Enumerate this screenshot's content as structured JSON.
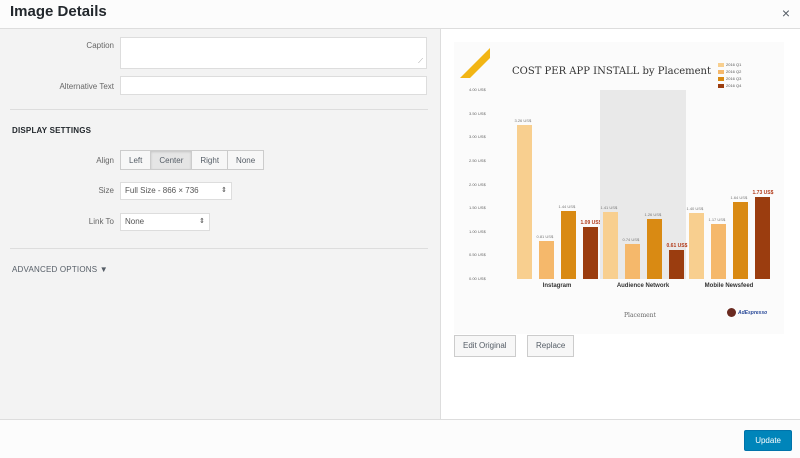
{
  "header": {
    "title": "Image Details",
    "close_glyph": "×"
  },
  "settings": {
    "caption_label": "Caption",
    "caption_value": "",
    "alt_text_label": "Alternative Text",
    "alt_text_value": "",
    "display_settings_title": "DISPLAY SETTINGS",
    "align_label": "Align",
    "align_options": [
      "Left",
      "Center",
      "Right",
      "None"
    ],
    "align_selected": "Center",
    "size_label": "Size",
    "size_value": "Full Size - 866 × 736",
    "link_to_label": "Link To",
    "link_to_value": "None",
    "advanced_options_label": "ADVANCED OPTIONS ▼"
  },
  "preview": {
    "edit_original_label": "Edit Original",
    "replace_label": "Replace"
  },
  "chart_data": {
    "type": "bar",
    "title": "COST PER APP INSTALL by Placement",
    "xlabel": "Placement",
    "ylabel": "",
    "categories": [
      "Instagram",
      "Audience Network",
      "Mobile Newsfeed"
    ],
    "series": [
      {
        "name": "2016 Q1",
        "color": "#f8cf8f",
        "values": [
          3.26,
          1.41,
          1.4
        ]
      },
      {
        "name": "2016 Q2",
        "color": "#f5b86b",
        "values": [
          0.81,
          0.74,
          1.17
        ]
      },
      {
        "name": "2016 Q3",
        "color": "#d98a13",
        "values": [
          1.44,
          1.26,
          1.64
        ]
      },
      {
        "name": "2016 Q4",
        "color": "#9b3d0f",
        "values": [
          1.09,
          0.61,
          1.73
        ]
      }
    ],
    "value_labels": [
      [
        "3.26 US$",
        "0.81 US$",
        "1.44 US$",
        "1.09 US$"
      ],
      [
        "1.41 US$",
        "0.74 US$",
        "1.26 US$",
        "0.61 US$"
      ],
      [
        "1.40 US$",
        "1.17 US$",
        "1.64 US$",
        "1.73 US$"
      ]
    ],
    "yticks": [
      "4.00 US$",
      "3.50 US$",
      "3.00 US$",
      "2.50 US$",
      "2.00 US$",
      "1.50 US$",
      "1.00 US$",
      "0.50 US$",
      "0.00 US$"
    ],
    "ylim": [
      0,
      4
    ],
    "highlighted_category": "Audience Network",
    "legend_position": "top-right",
    "grid": true
  },
  "logo_text": "AdEspresso",
  "footer": {
    "update_label": "Update"
  },
  "colors": {
    "accent": "#0085ba",
    "panel": "#f3f3f3",
    "highlight_value": "#b23b1a"
  }
}
